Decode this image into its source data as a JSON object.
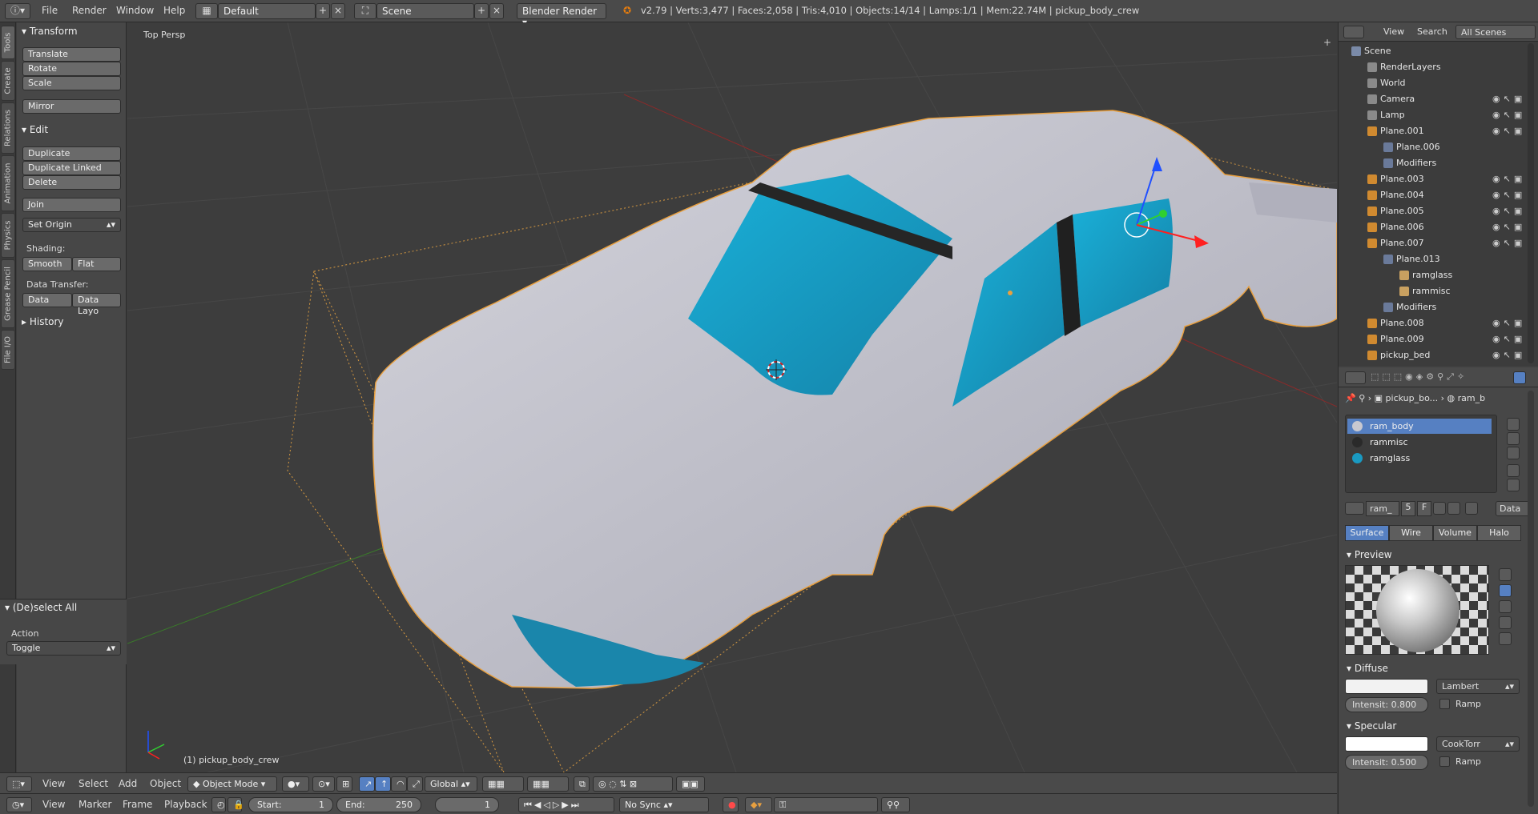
{
  "topbar": {
    "menus": [
      "File",
      "Render",
      "Window",
      "Help"
    ],
    "screen_layout": "Default",
    "scene": "Scene",
    "render_engine": "Blender Render",
    "stats": "v2.79 | Verts:3,477 | Faces:2,058 | Tris:4,010 | Objects:14/14 | Lamps:1/1 | Mem:22.74M | pickup_body_crew"
  },
  "left_tabs": [
    "Tools",
    "Create",
    "Relations",
    "Animation",
    "Physics",
    "Grease Pencil",
    "File I/O"
  ],
  "toolshelf": {
    "transform_title": "Transform",
    "transform_buttons": [
      "Translate",
      "Rotate",
      "Scale"
    ],
    "mirror": "Mirror",
    "edit_title": "Edit",
    "edit_buttons": [
      "Duplicate",
      "Duplicate Linked",
      "Delete"
    ],
    "join": "Join",
    "set_origin": "Set Origin",
    "shading_label": "Shading:",
    "smooth": "Smooth",
    "flat": "Flat",
    "data_transfer_label": "Data Transfer:",
    "data": "Data",
    "data_layout": "Data Layo",
    "history": "History"
  },
  "operator_panel": {
    "title": "(De)select All",
    "action_label": "Action",
    "action_value": "Toggle"
  },
  "viewport": {
    "view_name": "Top Persp",
    "object_info": "(1) pickup_body_crew",
    "glass_color": "#1a9ac2",
    "body_color": "#c8c8d0",
    "selection_color": "#e8a040"
  },
  "view3d_header": {
    "menus": [
      "View",
      "Select",
      "Add",
      "Object"
    ],
    "mode": "Object Mode",
    "orientation": "Global"
  },
  "timeline_header": {
    "menus": [
      "View",
      "Marker",
      "Frame",
      "Playback"
    ],
    "start": "Start:",
    "start_value": "1",
    "end": "End:",
    "end_value": "250",
    "current_frame": "1",
    "sync": "No Sync"
  },
  "outliner": {
    "header": [
      "View",
      "Search",
      "All Scenes"
    ],
    "rows": [
      {
        "name": "Scene",
        "indent": 0
      },
      {
        "name": "RenderLayers",
        "indent": 1
      },
      {
        "name": "World",
        "indent": 1
      },
      {
        "name": "Camera",
        "indent": 1
      },
      {
        "name": "Lamp",
        "indent": 1
      },
      {
        "name": "Plane.001",
        "indent": 1
      },
      {
        "name": "Plane.006",
        "indent": 2
      },
      {
        "name": "Modifiers",
        "indent": 2
      },
      {
        "name": "Plane.003",
        "indent": 1
      },
      {
        "name": "Plane.004",
        "indent": 1
      },
      {
        "name": "Plane.005",
        "indent": 1
      },
      {
        "name": "Plane.006",
        "indent": 1
      },
      {
        "name": "Plane.007",
        "indent": 1
      },
      {
        "name": "Plane.013",
        "indent": 2
      },
      {
        "name": "ramglass",
        "indent": 3
      },
      {
        "name": "rammisc",
        "indent": 3
      },
      {
        "name": "Modifiers",
        "indent": 2
      },
      {
        "name": "Plane.008",
        "indent": 1
      },
      {
        "name": "Plane.009",
        "indent": 1
      },
      {
        "name": "pickup_bed",
        "indent": 1
      }
    ]
  },
  "properties": {
    "breadcrumb_object": "pickup_bo...",
    "breadcrumb_material": "ram_b",
    "materials": [
      {
        "name": "ram_body",
        "color": "#c8c8d0"
      },
      {
        "name": "rammisc",
        "color": "#2a2a2a"
      },
      {
        "name": "ramglass",
        "color": "#1a9ac2"
      }
    ],
    "mat_name": "ram_",
    "users": "5",
    "fake": "F",
    "link": "Data",
    "tabs": [
      "Surface",
      "Wire",
      "Volume",
      "Halo"
    ],
    "preview_title": "Preview",
    "diffuse_title": "Diffuse",
    "diffuse_shader": "Lambert",
    "diffuse_intensity": "Intensit:  0.800",
    "ramp": "Ramp",
    "specular_title": "Specular",
    "specular_shader": "CookTorr",
    "specular_intensity": "Intensit:  0.500"
  }
}
